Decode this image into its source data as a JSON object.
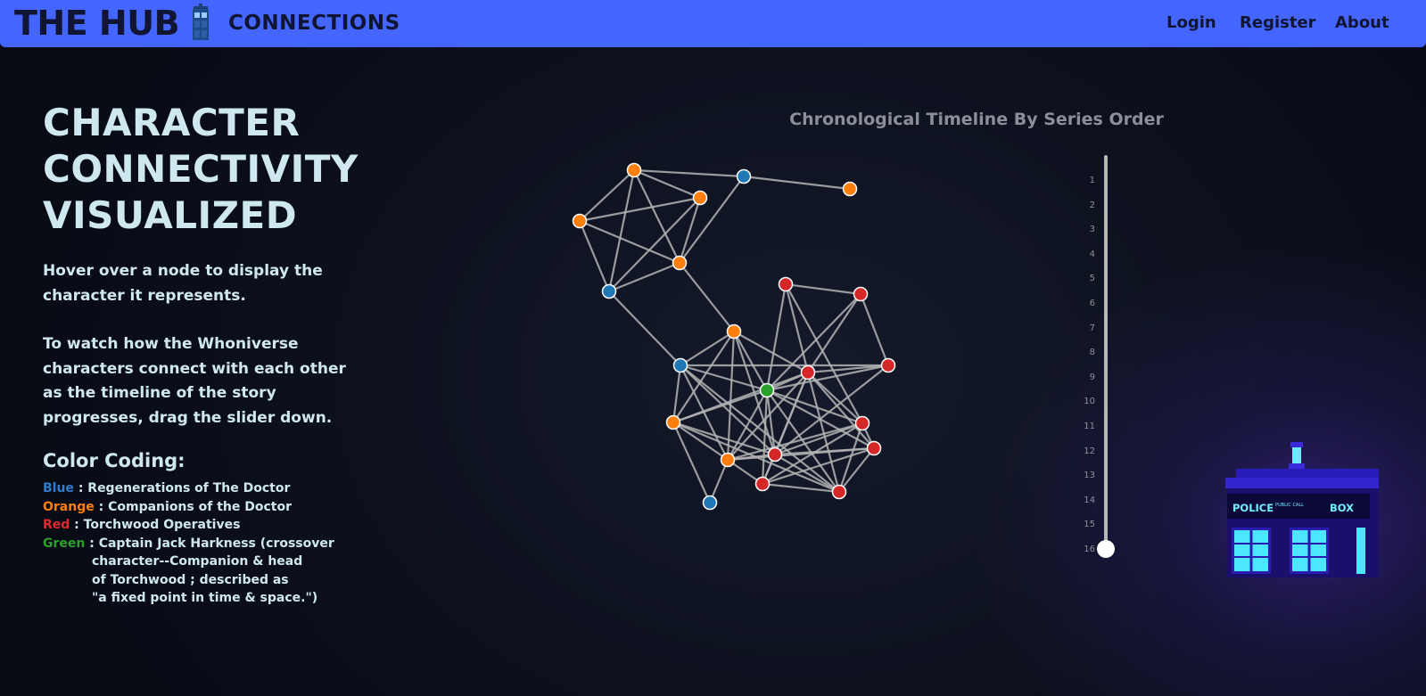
{
  "navbar": {
    "brand": "THE HUB",
    "subtitle": "CONNECTIONS",
    "links": [
      "Login",
      "Register",
      "About"
    ],
    "color": "#4466ff"
  },
  "intro": {
    "headline": [
      "CHARACTER",
      "CONNECTIVITY",
      "VISUALIZED"
    ],
    "hover_text": "Hover over a node to display the character it represents.",
    "timeline_text": "To watch how the Whoniverse characters connect with each other as the timeline of the story progresses, drag the slider down."
  },
  "legend": {
    "title": "Color Coding:",
    "items": [
      {
        "key": "Blue",
        "desc": ": Regenerations of The Doctor",
        "color": "#1f77b4"
      },
      {
        "key": "Orange",
        "desc": ": Companions of the Doctor",
        "color": "#ff7f0e"
      },
      {
        "key": "Red",
        "desc": ": Torchwood Operatives",
        "color": "#d62728"
      },
      {
        "key": "Green",
        "desc": ": Captain Jack Harkness (crossover",
        "color": "#2ca02c"
      }
    ],
    "green_continued": [
      "character--Companion & head",
      "of Torchwood ; described as",
      "\"a fixed point in time & space.\")"
    ]
  },
  "graph": {
    "title": "Chronological Timeline By Series Order",
    "node_groups": {
      "doctor": "#1f77b4",
      "companion": "#ff7f0e",
      "torchwood": "#d62728",
      "jack": "#2ca02c"
    },
    "nodes": [
      {
        "id": "o1",
        "group": "companion"
      },
      {
        "id": "b1",
        "group": "doctor"
      },
      {
        "id": "o2",
        "group": "companion"
      },
      {
        "id": "o3",
        "group": "companion"
      },
      {
        "id": "o4",
        "group": "companion"
      },
      {
        "id": "o5",
        "group": "companion"
      },
      {
        "id": "b2",
        "group": "doctor"
      },
      {
        "id": "r1",
        "group": "torchwood"
      },
      {
        "id": "r2",
        "group": "torchwood"
      },
      {
        "id": "o6",
        "group": "companion"
      },
      {
        "id": "b3",
        "group": "doctor"
      },
      {
        "id": "r3",
        "group": "torchwood"
      },
      {
        "id": "r4",
        "group": "torchwood"
      },
      {
        "id": "g1",
        "group": "jack"
      },
      {
        "id": "o7",
        "group": "companion"
      },
      {
        "id": "r5",
        "group": "torchwood"
      },
      {
        "id": "r6",
        "group": "torchwood"
      },
      {
        "id": "o8",
        "group": "companion"
      },
      {
        "id": "r7",
        "group": "torchwood"
      },
      {
        "id": "r8",
        "group": "torchwood"
      },
      {
        "id": "r9",
        "group": "torchwood"
      },
      {
        "id": "b4",
        "group": "doctor"
      }
    ],
    "links": [
      [
        "o1",
        "b1"
      ],
      [
        "b1",
        "o2"
      ],
      [
        "o1",
        "o3"
      ],
      [
        "o1",
        "o4"
      ],
      [
        "o1",
        "o5"
      ],
      [
        "o1",
        "b2"
      ],
      [
        "o4",
        "o3"
      ],
      [
        "o4",
        "o5"
      ],
      [
        "o4",
        "b2"
      ],
      [
        "o3",
        "o5"
      ],
      [
        "o3",
        "b2"
      ],
      [
        "o5",
        "b2"
      ],
      [
        "o5",
        "b1"
      ],
      [
        "o5",
        "o6"
      ],
      [
        "b2",
        "b3"
      ],
      [
        "r1",
        "r2"
      ],
      [
        "r1",
        "g1"
      ],
      [
        "r1",
        "r3"
      ],
      [
        "r1",
        "r5"
      ],
      [
        "r2",
        "r3"
      ],
      [
        "r2",
        "r4"
      ],
      [
        "r2",
        "g1"
      ],
      [
        "o6",
        "b3"
      ],
      [
        "o6",
        "g1"
      ],
      [
        "o6",
        "r3"
      ],
      [
        "o6",
        "o7"
      ],
      [
        "o6",
        "o8"
      ],
      [
        "o6",
        "r6"
      ],
      [
        "b3",
        "r4"
      ],
      [
        "b3",
        "g1"
      ],
      [
        "b3",
        "o7"
      ],
      [
        "b3",
        "o8"
      ],
      [
        "b3",
        "r6"
      ],
      [
        "b3",
        "r9"
      ],
      [
        "r3",
        "r4"
      ],
      [
        "r3",
        "g1"
      ],
      [
        "r3",
        "r5"
      ],
      [
        "r3",
        "r6"
      ],
      [
        "r3",
        "o8"
      ],
      [
        "r3",
        "r7"
      ],
      [
        "r3",
        "r8"
      ],
      [
        "r3",
        "r9"
      ],
      [
        "r3",
        "o7"
      ],
      [
        "g1",
        "r4"
      ],
      [
        "g1",
        "o7"
      ],
      [
        "g1",
        "r5"
      ],
      [
        "g1",
        "r6"
      ],
      [
        "g1",
        "o8"
      ],
      [
        "g1",
        "r8"
      ],
      [
        "g1",
        "r9"
      ],
      [
        "g1",
        "r7"
      ],
      [
        "o7",
        "o8"
      ],
      [
        "o7",
        "r6"
      ],
      [
        "o7",
        "r9"
      ],
      [
        "o8",
        "r6"
      ],
      [
        "o8",
        "b4"
      ],
      [
        "o7",
        "b4"
      ],
      [
        "r5",
        "r6"
      ],
      [
        "r5",
        "o8"
      ],
      [
        "r5",
        "r9"
      ],
      [
        "r5",
        "r8"
      ],
      [
        "r5",
        "r7"
      ],
      [
        "r6",
        "r7"
      ],
      [
        "r6",
        "r9"
      ],
      [
        "r6",
        "r8"
      ],
      [
        "r4",
        "r6"
      ],
      [
        "r7",
        "r9"
      ],
      [
        "r8",
        "r9"
      ],
      [
        "r7",
        "r8"
      ],
      [
        "o8",
        "r8"
      ],
      [
        "o8",
        "r7"
      ]
    ]
  },
  "timeline": {
    "ticks": [
      "1",
      "2",
      "3",
      "4",
      "5",
      "6",
      "7",
      "8",
      "9",
      "10",
      "11",
      "12",
      "13",
      "14",
      "15",
      "16"
    ],
    "value": 16,
    "min": 1,
    "max": 16
  },
  "tardis": {
    "sign_left": "POLICE",
    "sign_small": "PUBLIC CALL",
    "sign_right": "BOX"
  }
}
